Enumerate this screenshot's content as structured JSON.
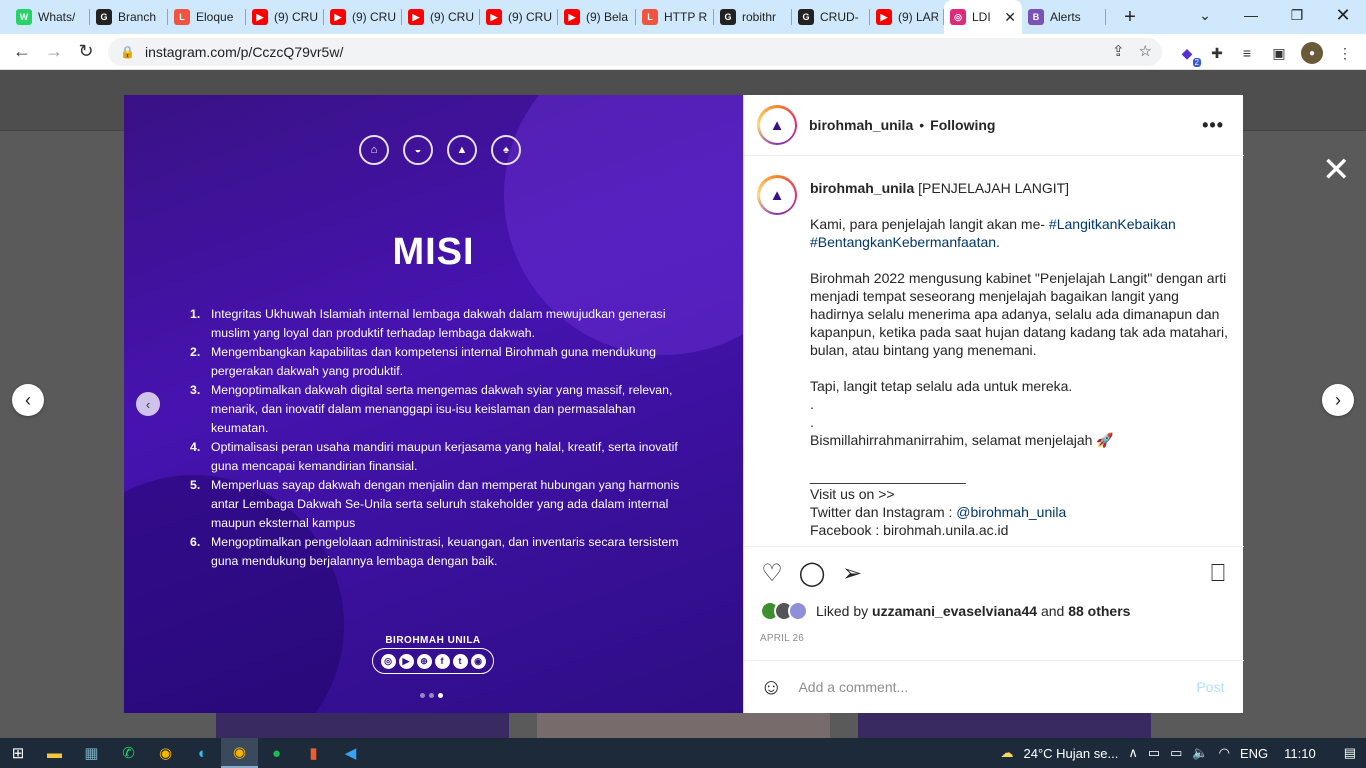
{
  "browser": {
    "tabs": [
      {
        "label": "Whats/",
        "icon": "whatsapp-icon",
        "color": "#25d366",
        "glyph": "W"
      },
      {
        "label": "Branch",
        "icon": "github-icon",
        "color": "#222222",
        "glyph": "G"
      },
      {
        "label": "Eloque",
        "icon": "laravel-icon",
        "color": "#f05340",
        "glyph": "L"
      },
      {
        "label": "(9) CRU",
        "icon": "youtube-icon",
        "color": "#ff0000",
        "glyph": "▶"
      },
      {
        "label": "(9) CRU",
        "icon": "youtube-icon",
        "color": "#ff0000",
        "glyph": "▶"
      },
      {
        "label": "(9) CRU",
        "icon": "youtube-icon",
        "color": "#ff0000",
        "glyph": "▶"
      },
      {
        "label": "(9) CRU",
        "icon": "youtube-icon",
        "color": "#ff0000",
        "glyph": "▶"
      },
      {
        "label": "(9) Bela",
        "icon": "youtube-icon",
        "color": "#ff0000",
        "glyph": "▶"
      },
      {
        "label": "HTTP R",
        "icon": "laravel-icon",
        "color": "#f05340",
        "glyph": "L"
      },
      {
        "label": "robithr",
        "icon": "github-icon",
        "color": "#222222",
        "glyph": "G"
      },
      {
        "label": "CRUD-",
        "icon": "github-icon",
        "color": "#222222",
        "glyph": "G"
      },
      {
        "label": "(9) LAR",
        "icon": "youtube-icon",
        "color": "#ff0000",
        "glyph": "▶"
      },
      {
        "label": "LDI",
        "icon": "instagram-icon",
        "color": "#dd2a7b",
        "glyph": "◎",
        "active": true
      },
      {
        "label": "Alerts",
        "icon": "bootstrap-icon",
        "color": "#7952b3",
        "glyph": "B"
      }
    ],
    "url": "instagram.com/p/CczcQ79vr5w/",
    "ext_badge": "2"
  },
  "post": {
    "image": {
      "title": "MISI",
      "items": [
        {
          "n": "1.",
          "text": "Integritas Ukhuwah Islamiah internal lembaga dakwah dalam mewujudkan generasi muslim yang loyal dan produktif terhadap lembaga dakwah."
        },
        {
          "n": "2.",
          "text": "Mengembangkan kapabilitas dan kompetensi internal Birohmah guna mendukung pergerakan dakwah yang produktif."
        },
        {
          "n": "3.",
          "text": "Mengoptimalkan dakwah digital serta mengemas dakwah syiar yang massif, relevan, menarik, dan inovatif dalam menanggapi isu-isu keislaman dan permasalahan keumatan."
        },
        {
          "n": "4.",
          "text": "Optimalisasi peran usaha mandiri maupun kerjasama yang halal, kreatif, serta inovatif guna mencapai kemandirian finansial."
        },
        {
          "n": "5.",
          "text": "Memperluas sayap dakwah dengan menjalin dan memperat hubungan yang harmonis antar Lembaga Dakwah Se-Unila serta seluruh stakeholder yang ada dalam internal maupun eksternal kampus"
        },
        {
          "n": "6.",
          "text": "Mengoptimalkan pengelolaan administrasi, keuangan, dan inventaris secara tersistem guna mendukung berjalannya lembaga dengan baik."
        }
      ],
      "brand": "BIROHMAH UNILA"
    },
    "header": {
      "username": "birohmah_unila",
      "separator": "•",
      "follow": "Following"
    },
    "caption": {
      "username": "birohmah_unila",
      "title": "[PENJELAJAH LANGIT]",
      "line1": "Kami, para penjelajah langit akan me-",
      "tag1": "#LangitkanKebaikan",
      "tag2": "#BentangkanKebermanfaatan",
      "line1_end": ".",
      "para2": "Birohmah 2022 mengusung kabinet \"Penjelajah Langit\" dengan arti menjadi tempat seseorang menjelajah bagaikan langit yang hadirnya selalu menerima apa adanya, selalu ada dimanapun dan kapanpun, ketika pada saat hujan datang kadang tak ada matahari, bulan, atau bintang yang menemani.",
      "para3": "Tapi, langit tetap selalu ada untuk mereka.",
      "dot": ".",
      "closing": "Bismillahirrahmanirrahim, selamat menjelajah 🚀",
      "rule": "____________________",
      "visit": "Visit us on >>",
      "twitter": "Twitter dan Instagram :",
      "twitter_handle": "@birohmah_unila",
      "facebook": "Facebook : birohmah.unila.ac.id"
    },
    "likes": {
      "prefix": "Liked by",
      "user": "uzzamani_evaselviana44",
      "and": "and",
      "others": "88 others"
    },
    "date": "APRIL 26",
    "comment": {
      "placeholder": "Add a comment...",
      "post": "Post"
    }
  },
  "taskbar": {
    "weather": "24°C  Hujan se...",
    "lang": "ENG",
    "time": "11:10"
  }
}
